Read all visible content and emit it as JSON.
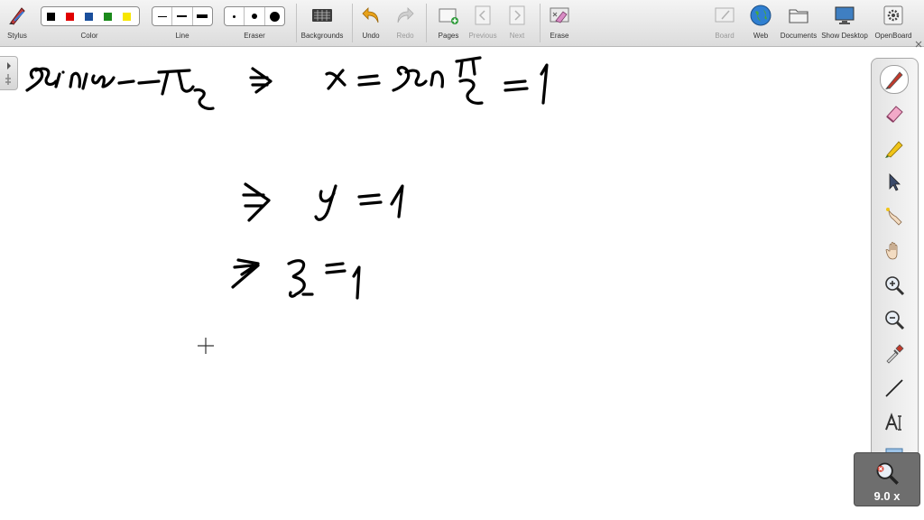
{
  "toolbar": {
    "stylus": "Stylus",
    "color": "Color",
    "line": "Line",
    "eraser": "Eraser",
    "backgrounds": "Backgrounds",
    "undo": "Undo",
    "redo": "Redo",
    "pages": "Pages",
    "previous": "Previous",
    "next": "Next",
    "erase": "Erase",
    "board": "Board",
    "web": "Web",
    "documents": "Documents",
    "show_desktop": "Show Desktop",
    "openboard": "OpenBoard"
  },
  "palette_colors": [
    "#000000",
    "#e00000",
    "#1a4f9c",
    "#1b8a1b",
    "#f7e600"
  ],
  "side_tools": [
    "pen-icon",
    "eraser-icon",
    "highlighter-icon",
    "pointer-icon",
    "laser-pointer-icon",
    "hand-icon",
    "zoom-in-icon",
    "zoom-out-icon",
    "pipette-icon",
    "line-icon",
    "text-icon",
    "capture-icon"
  ],
  "zoom": {
    "label": "9.0 x"
  },
  "accent": "#4a8fd6"
}
